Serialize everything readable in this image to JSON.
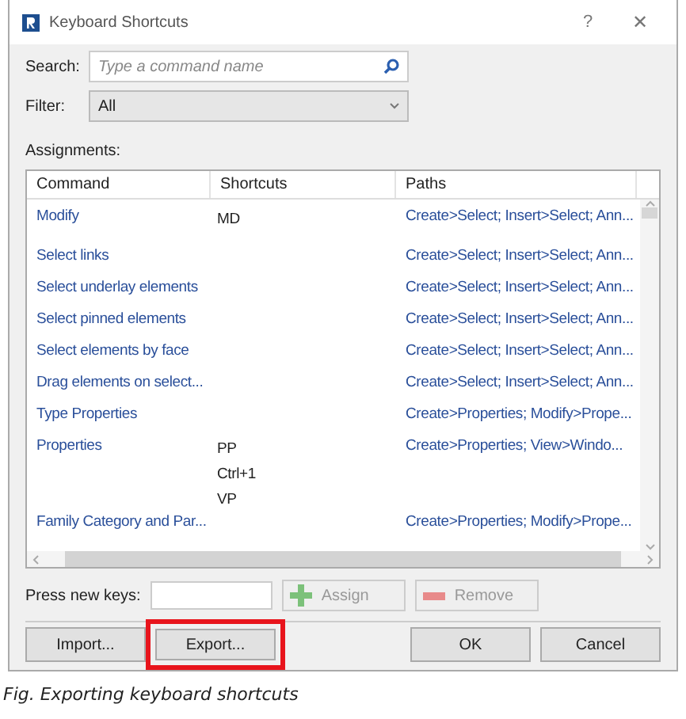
{
  "window": {
    "title": "Keyboard Shortcuts",
    "help": "?",
    "close": "✕"
  },
  "search": {
    "label": "Search:",
    "placeholder": "Type a command name"
  },
  "filter": {
    "label": "Filter:",
    "value": "All"
  },
  "assignments_label": "Assignments:",
  "table": {
    "columns": [
      "Command",
      "Shortcuts",
      "Paths"
    ],
    "rows": [
      {
        "command": "Modify",
        "shortcuts": [
          "MD"
        ],
        "path": "Create>Select; Insert>Select; Ann..."
      },
      {
        "command": "Select links",
        "shortcuts": [],
        "path": "Create>Select; Insert>Select; Ann..."
      },
      {
        "command": "Select underlay elements",
        "shortcuts": [],
        "path": "Create>Select; Insert>Select; Ann..."
      },
      {
        "command": "Select pinned elements",
        "shortcuts": [],
        "path": "Create>Select; Insert>Select; Ann..."
      },
      {
        "command": "Select elements by face",
        "shortcuts": [],
        "path": "Create>Select; Insert>Select; Ann..."
      },
      {
        "command": "Drag elements on select...",
        "shortcuts": [],
        "path": "Create>Select; Insert>Select; Ann..."
      },
      {
        "command": "Type Properties",
        "shortcuts": [],
        "path": "Create>Properties; Modify>Prope..."
      },
      {
        "command": "Properties",
        "shortcuts": [
          "PP",
          "Ctrl+1",
          "VP"
        ],
        "path": "Create>Properties; View>Windo..."
      },
      {
        "command": "Family Category and Par...",
        "shortcuts": [],
        "path": "Create>Properties; Modify>Prope..."
      }
    ]
  },
  "new_keys": {
    "label": "Press new keys:"
  },
  "key_buttons": [
    {
      "label": "Assign",
      "kind": "plus",
      "disabled": true
    },
    {
      "label": "Remove",
      "kind": "minus",
      "disabled": true
    }
  ],
  "footer_buttons": [
    {
      "label": "Import...",
      "highlighted": false
    },
    {
      "label": "Export...",
      "highlighted": true
    },
    {
      "label": "OK",
      "highlighted": false
    },
    {
      "label": "Cancel",
      "highlighted": false
    }
  ],
  "caption": "Fig. Exporting keyboard shortcuts"
}
